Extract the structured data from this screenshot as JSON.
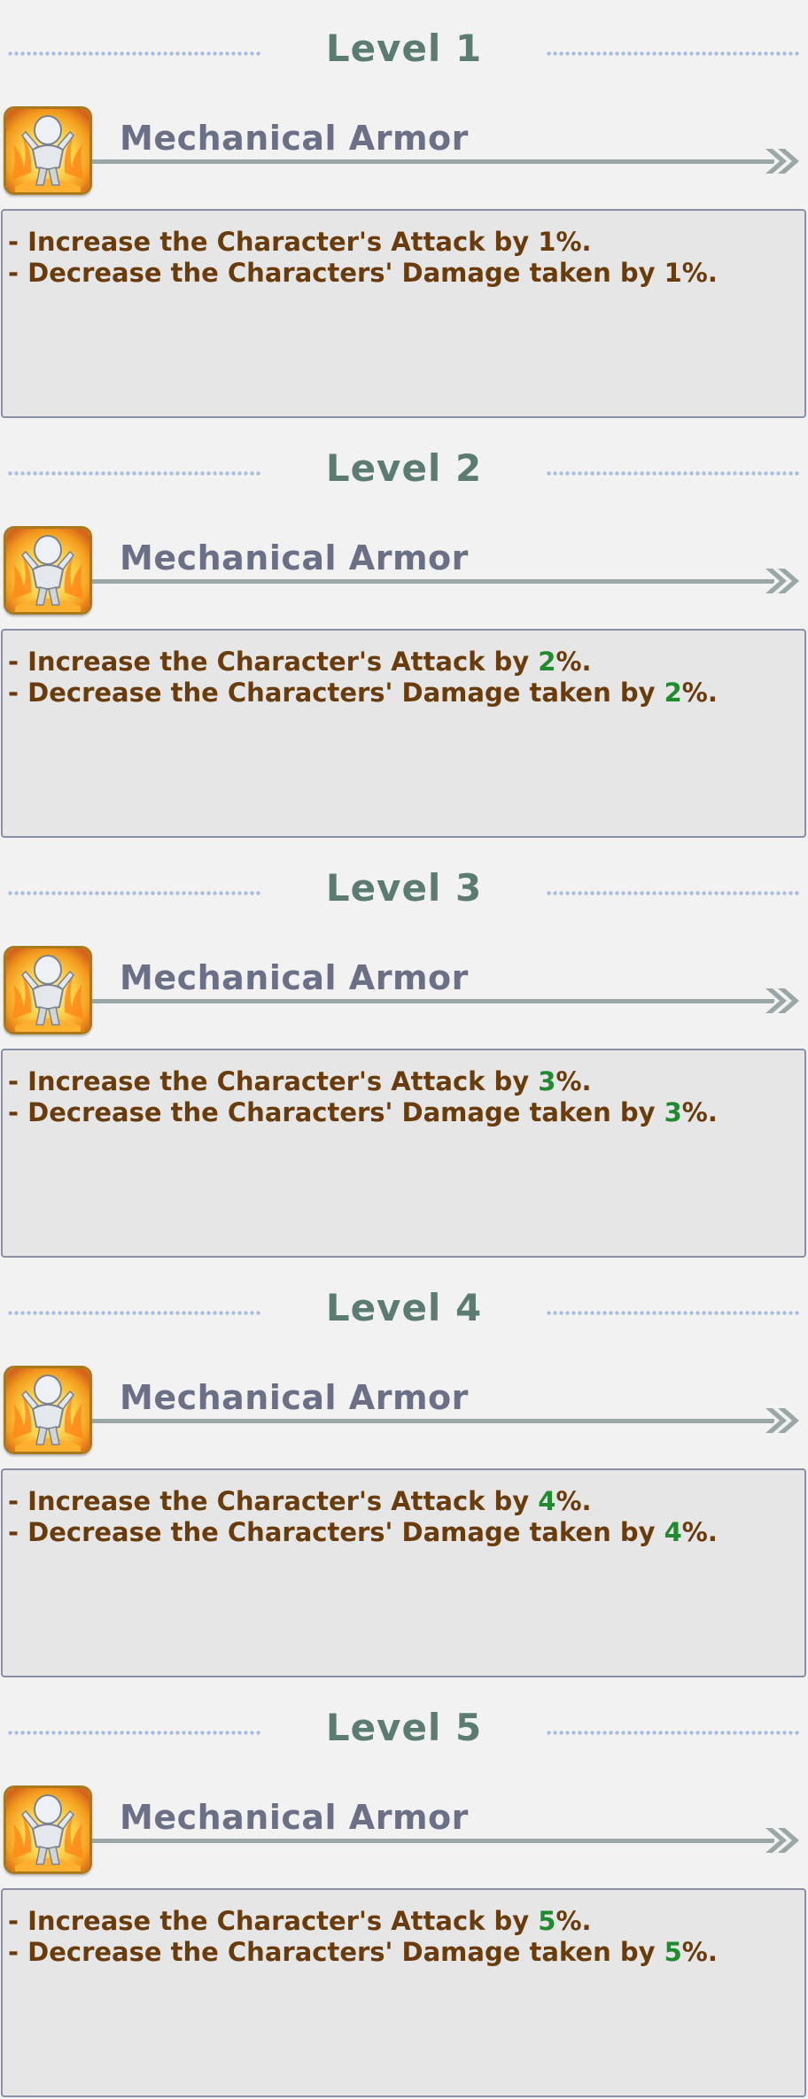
{
  "levels": [
    {
      "title": "Level 1",
      "skill_name": "Mechanical Armor",
      "line1_prefix": "- Increase the Character's Attack by ",
      "line1_value": "1",
      "line1_suffix": "%.",
      "line2_prefix": "- Decrease the Characters' Damage taken by ",
      "line2_value": "1",
      "line2_suffix": "%.",
      "value_highlight": false
    },
    {
      "title": "Level 2",
      "skill_name": "Mechanical Armor",
      "line1_prefix": "- Increase the Character's Attack by ",
      "line1_value": "2",
      "line1_suffix": "%.",
      "line2_prefix": "- Decrease the Characters' Damage taken by ",
      "line2_value": "2",
      "line2_suffix": "%.",
      "value_highlight": true
    },
    {
      "title": "Level 3",
      "skill_name": "Mechanical Armor",
      "line1_prefix": "- Increase the Character's Attack by ",
      "line1_value": "3",
      "line1_suffix": "%.",
      "line2_prefix": "- Decrease the Characters' Damage taken by ",
      "line2_value": "3",
      "line2_suffix": "%.",
      "value_highlight": true
    },
    {
      "title": "Level 4",
      "skill_name": "Mechanical Armor",
      "line1_prefix": "- Increase the Character's Attack by ",
      "line1_value": "4",
      "line1_suffix": "%.",
      "line2_prefix": "- Decrease the Characters' Damage taken by ",
      "line2_value": "4",
      "line2_suffix": "%.",
      "value_highlight": true
    },
    {
      "title": "Level 5",
      "skill_name": "Mechanical Armor",
      "line1_prefix": "- Increase the Character's Attack by ",
      "line1_value": "5",
      "line1_suffix": "%.",
      "line2_prefix": "- Decrease the Characters' Damage taken by ",
      "line2_value": "5",
      "line2_suffix": "%.",
      "value_highlight": true
    }
  ],
  "icons": {
    "skill": "mechanical-armor-skill-icon",
    "arrow": "double-chevron-right-icon"
  },
  "colors": {
    "level_title": "#5c7b73",
    "skill_name": "#6b7087",
    "description_text": "#6a3c0c",
    "value_increase": "#1f8a2e",
    "box_border": "#8a8fa6",
    "dots": "#a9bde0"
  }
}
